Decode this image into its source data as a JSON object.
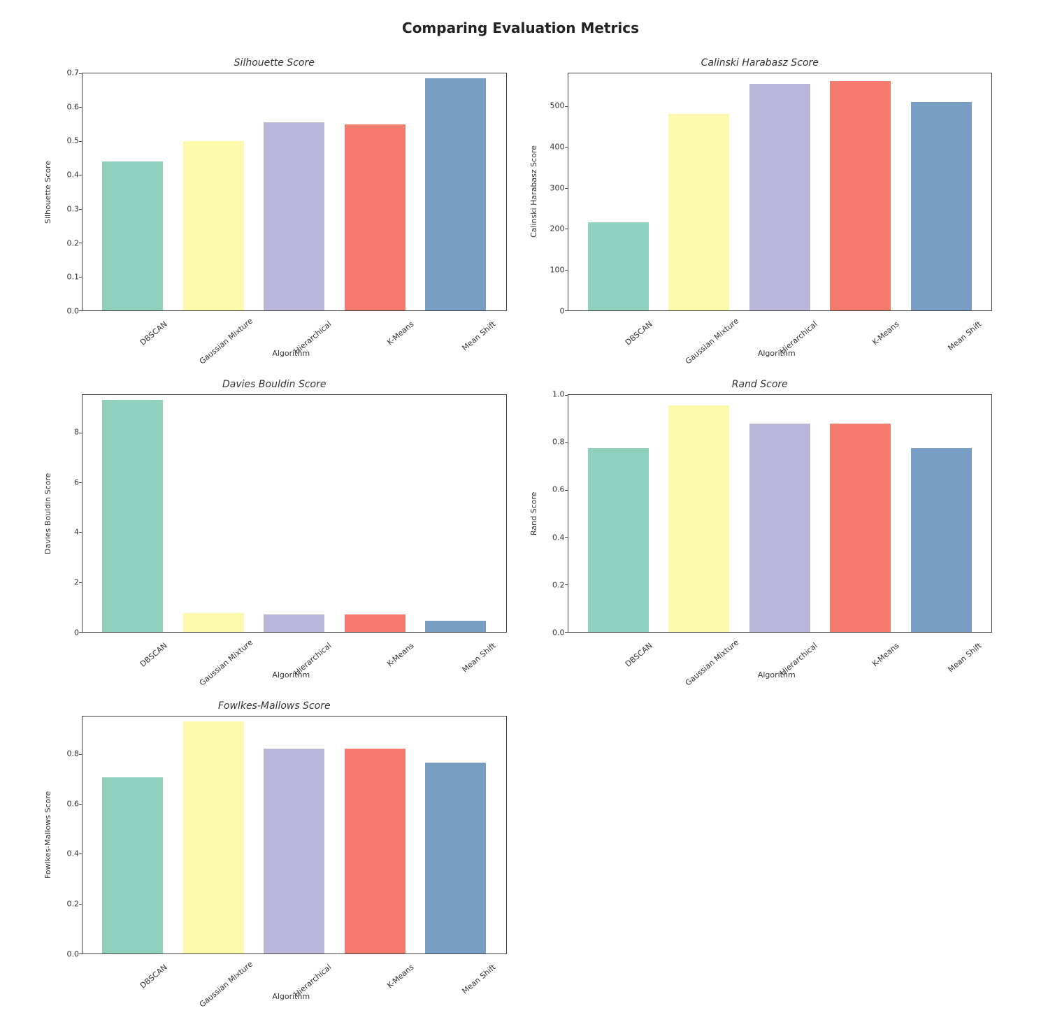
{
  "suptitle": "Comparing Evaluation Metrics",
  "categories": [
    "DBSCAN",
    "Gaussian Mixture",
    "Hierarchical",
    "K-Means",
    "Mean Shift"
  ],
  "colors": [
    "#8fd1bd",
    "#fcfaaa",
    "#b8b5d6",
    "#f47a6e",
    "#789fc3"
  ],
  "xlabel": "Algorithm",
  "panels": [
    {
      "title": "Silhouette Score",
      "ylabel": "Silhouette Score"
    },
    {
      "title": "Calinski Harabasz Score",
      "ylabel": "Calinski Harabasz Score"
    },
    {
      "title": "Davies Bouldin Score",
      "ylabel": "Davies Bouldin Score"
    },
    {
      "title": "Rand Score",
      "ylabel": "Rand Score"
    },
    {
      "title": "Fowlkes-Mallows Score",
      "ylabel": "Fowlkes-Mallows Score"
    }
  ],
  "chart_data": [
    {
      "type": "bar",
      "title": "Silhouette Score",
      "xlabel": "Algorithm",
      "ylabel": "Silhouette Score",
      "categories": [
        "DBSCAN",
        "Gaussian Mixture",
        "Hierarchical",
        "K-Means",
        "Mean Shift"
      ],
      "values": [
        0.44,
        0.5,
        0.555,
        0.55,
        0.685
      ],
      "ylim": [
        0.0,
        0.7
      ],
      "yticks": [
        0.0,
        0.1,
        0.2,
        0.3,
        0.4,
        0.5,
        0.6,
        0.7
      ]
    },
    {
      "type": "bar",
      "title": "Calinski Harabasz Score",
      "xlabel": "Algorithm",
      "ylabel": "Calinski Harabasz Score",
      "categories": [
        "DBSCAN",
        "Gaussian Mixture",
        "Hierarchical",
        "K-Means",
        "Mean Shift"
      ],
      "values": [
        215,
        480,
        555,
        562,
        510
      ],
      "ylim": [
        0,
        580
      ],
      "yticks": [
        0,
        100,
        200,
        300,
        400,
        500
      ]
    },
    {
      "type": "bar",
      "title": "Davies Bouldin Score",
      "xlabel": "Algorithm",
      "ylabel": "Davies Bouldin Score",
      "categories": [
        "DBSCAN",
        "Gaussian Mixture",
        "Hierarchical",
        "K-Means",
        "Mean Shift"
      ],
      "values": [
        9.3,
        0.75,
        0.7,
        0.7,
        0.45
      ],
      "ylim": [
        0,
        9.5
      ],
      "yticks": [
        0,
        2,
        4,
        6,
        8
      ]
    },
    {
      "type": "bar",
      "title": "Rand Score",
      "xlabel": "Algorithm",
      "ylabel": "Rand Score",
      "categories": [
        "DBSCAN",
        "Gaussian Mixture",
        "Hierarchical",
        "K-Means",
        "Mean Shift"
      ],
      "values": [
        0.775,
        0.955,
        0.88,
        0.88,
        0.775
      ],
      "ylim": [
        0.0,
        1.0
      ],
      "yticks": [
        0.0,
        0.2,
        0.4,
        0.6,
        0.8,
        1.0
      ]
    },
    {
      "type": "bar",
      "title": "Fowlkes-Mallows Score",
      "xlabel": "Algorithm",
      "ylabel": "Fowlkes-Mallows Score",
      "categories": [
        "DBSCAN",
        "Gaussian Mixture",
        "Hierarchical",
        "K-Means",
        "Mean Shift"
      ],
      "values": [
        0.705,
        0.93,
        0.82,
        0.82,
        0.765
      ],
      "ylim": [
        0.0,
        0.95
      ],
      "yticks": [
        0.0,
        0.2,
        0.4,
        0.6,
        0.8
      ]
    }
  ]
}
